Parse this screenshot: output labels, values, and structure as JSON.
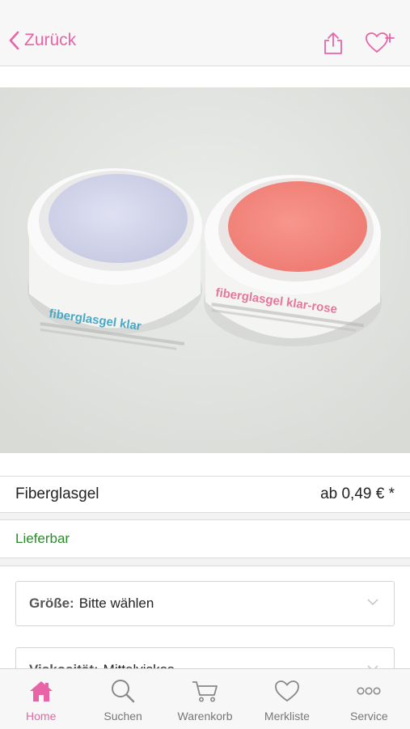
{
  "nav": {
    "back_label": "Zurück",
    "share_icon": "share-icon",
    "wishlist_add_icon": "heart-plus-icon",
    "accent": "#e964a6"
  },
  "product": {
    "image": {
      "jar_left_label": "fiberglasgel klar",
      "jar_right_label": "fiberglasgel klar-rose"
    },
    "name": "Fiberglasgel",
    "price": "ab 0,49 € *",
    "availability": "Lieferbar",
    "availability_color": "#2b8a2b"
  },
  "options": [
    {
      "label": "Größe:",
      "value": "Bitte wählen"
    },
    {
      "label": "Viskosität:",
      "value": "Mittelviskos"
    }
  ],
  "tabs": [
    {
      "label": "Home",
      "icon": "home-icon",
      "active": true
    },
    {
      "label": "Suchen",
      "icon": "search-icon",
      "active": false
    },
    {
      "label": "Warenkorb",
      "icon": "cart-icon",
      "active": false
    },
    {
      "label": "Merkliste",
      "icon": "heart-icon",
      "active": false
    },
    {
      "label": "Service",
      "icon": "more-icon",
      "active": false
    }
  ]
}
